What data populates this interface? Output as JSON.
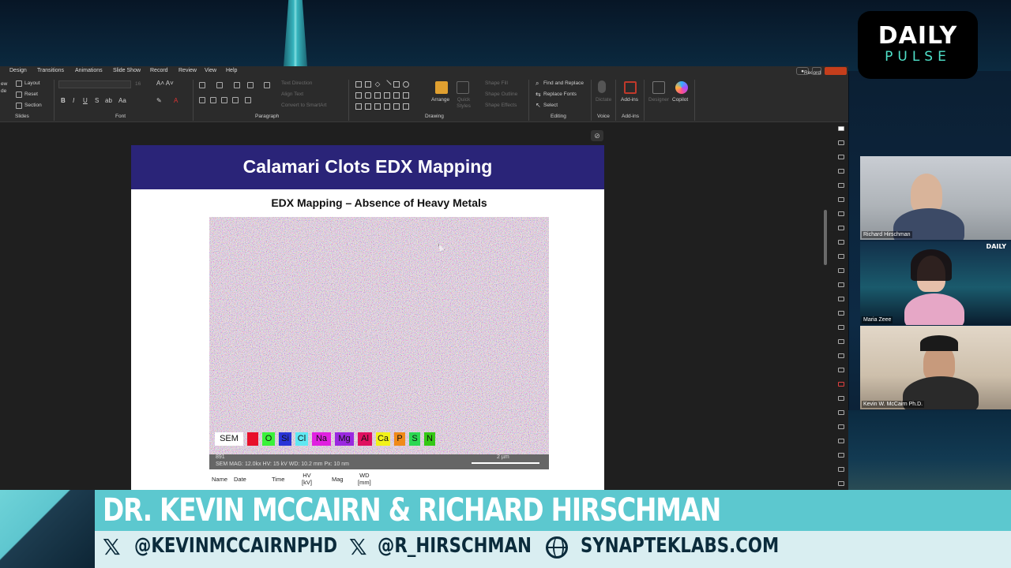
{
  "brand": {
    "line1": "DAILY",
    "line2": "PULSE",
    "mini": "DAILY"
  },
  "ppt": {
    "menu": [
      "Design",
      "Transitions",
      "Animations",
      "Slide Show",
      "Record",
      "Review",
      "View",
      "Help"
    ],
    "record_button": "Record",
    "ribbon": {
      "slides": {
        "layout": "Layout",
        "reset": "Reset",
        "section": "Section",
        "label": "Slides",
        "left_cut": "ew\nde"
      },
      "font": {
        "label": "Font",
        "size": "16"
      },
      "paragraph": {
        "label": "Paragraph",
        "text_direction": "Text Direction",
        "align_text": "Align Text",
        "convert": "Convert to SmartArt"
      },
      "drawing": {
        "label": "Drawing",
        "arrange": "Arrange",
        "quick_styles": "Quick Styles",
        "shape_fill": "Shape Fill",
        "shape_outline": "Shape Outline",
        "shape_effects": "Shape Effects"
      },
      "editing": {
        "label": "Editing",
        "find_replace": "Find and Replace",
        "replace_fonts": "Replace Fonts",
        "select": "Select"
      },
      "voice": {
        "label": "Voice",
        "dictate": "Dictate"
      },
      "addins": {
        "label": "Add-ins",
        "addins": "Add-ins",
        "designer": "Designer",
        "copilot": "Copilot"
      }
    }
  },
  "slide": {
    "title": "Calamari Clots EDX Mapping",
    "subtitle": "EDX Mapping – Absence of Heavy Metals",
    "legend": [
      {
        "label": "SEM",
        "color": "#ffffff"
      },
      {
        "label": "",
        "color": "#e8102a"
      },
      {
        "label": "O",
        "color": "#3af23a"
      },
      {
        "label": "Si",
        "color": "#2a35d8"
      },
      {
        "label": "Cl",
        "color": "#5fe8f2"
      },
      {
        "label": "Na",
        "color": "#e020e0"
      },
      {
        "label": "Mg",
        "color": "#9a28e0"
      },
      {
        "label": "Al",
        "color": "#e01060"
      },
      {
        "label": "Ca",
        "color": "#f2f21a"
      },
      {
        "label": "P",
        "color": "#f08a18"
      },
      {
        "label": "S",
        "color": "#2cd852"
      },
      {
        "label": "N",
        "color": "#34c814"
      }
    ],
    "sem_info": {
      "id": "891",
      "line": "SEM    MAG: 12.0kx   HV: 15 kV   WD: 10.2 mm   Px: 10 nm",
      "scale": "2 µm"
    },
    "meta_headers": [
      "Name",
      "Date",
      "Time",
      "HV\n[kV]",
      "Mag",
      "WD\n[mm]"
    ]
  },
  "participants": [
    {
      "name": "Richard Hirschman"
    },
    {
      "name": "Maria Zeee"
    },
    {
      "name": "Kevin W. McCairn Ph.D."
    }
  ],
  "lower_third": {
    "title": "DR. KEVIN MCCAIRN & RICHARD HIRSCHMAN",
    "x_icon": "𝕏",
    "handle1": "@KEVINMCCAIRNPHD",
    "handle2": "@R_HIRSCHMAN",
    "website": "SYNAPTEKLABS.COM"
  },
  "colors": {
    "slide_header": "#2a2478",
    "teal": "#5cc8cf",
    "ppt_bg": "#1f1f1f",
    "ribbon_bg": "#2b2b2b"
  }
}
